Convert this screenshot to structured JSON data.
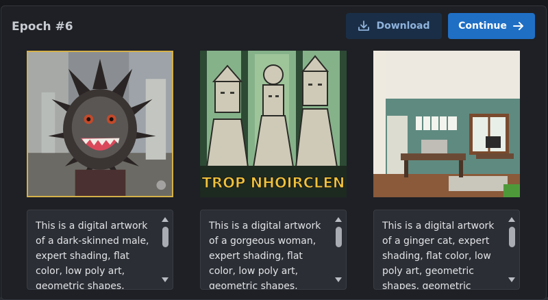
{
  "header": {
    "title": "Epoch #6",
    "download_label": "Download",
    "continue_label": "Continue"
  },
  "cards": [
    {
      "caption": "This is a digital artwork of a dark-skinned male, expert shading, flat color, low poly art, geometric shapes, geometric",
      "selected": true
    },
    {
      "caption": "This is a digital artwork of a gorgeous woman, expert shading, flat color, low poly art, geometric shapes, geometric",
      "image_text": "TROP NHOIRCLEN",
      "selected": false
    },
    {
      "caption": "This is a digital artwork of a ginger cat, expert shading, flat color, low poly art, geometric shapes, geometric",
      "selected": false
    }
  ],
  "colors": {
    "accent": "#1f6fc5",
    "selected_border": "#d6b14a"
  }
}
